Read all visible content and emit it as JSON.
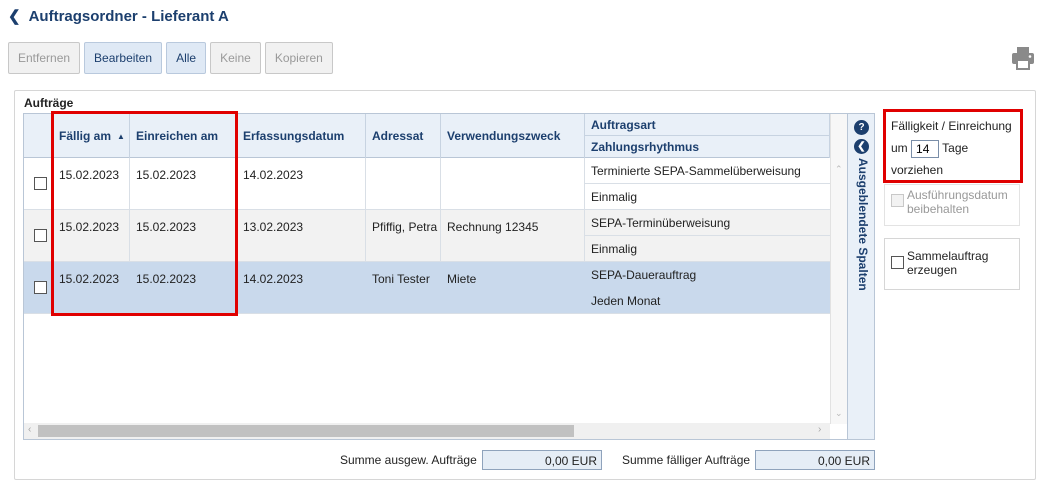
{
  "header": {
    "title": "Auftragsordner - Lieferant A"
  },
  "toolbar": {
    "buttons": [
      {
        "label": "Entfernen"
      },
      {
        "label": "Bearbeiten"
      },
      {
        "label": "Alle"
      },
      {
        "label": "Keine"
      },
      {
        "label": "Kopieren"
      }
    ]
  },
  "group": {
    "label": "Aufträge"
  },
  "table": {
    "columns": {
      "faellig": "Fällig am",
      "einreichen": "Einreichen am",
      "erfassung": "Erfassungsdatum",
      "adressat": "Adressat",
      "verwendung": "Verwendungszweck",
      "auftragsart": "Auftragsart",
      "rhythmus": "Zahlungsrhythmus"
    },
    "rows": [
      {
        "faellig": "15.02.2023",
        "einreichen": "15.02.2023",
        "erfassung": "14.02.2023",
        "adressat": "",
        "verwendung": "",
        "auftragsart": "Terminierte SEPA-Sammelüberweisung",
        "rhythmus": "Einmalig",
        "selected": false
      },
      {
        "faellig": "15.02.2023",
        "einreichen": "15.02.2023",
        "erfassung": "13.02.2023",
        "adressat": "Pfiffig, Petra",
        "verwendung": "Rechnung 12345",
        "auftragsart": "SEPA-Terminüberweisung",
        "rhythmus": "Einmalig",
        "selected": false
      },
      {
        "faellig": "15.02.2023",
        "einreichen": "15.02.2023",
        "erfassung": "14.02.2023",
        "adressat": "Toni Tester",
        "verwendung": "Miete",
        "auftragsart": "SEPA-Dauerauftrag",
        "rhythmus": "Jeden Monat",
        "selected": true
      }
    ],
    "hidden_columns_label": "Ausgeblendete Spalten"
  },
  "options": {
    "title": "Fälligkeit / Einreichung",
    "prefix": "um",
    "days": "14",
    "suffix": "Tage",
    "action": "vorziehen",
    "keep_date": {
      "line1": "Ausführungsdatum",
      "line2": "beibehalten"
    },
    "bulk": {
      "line1": "Sammelauftrag",
      "line2": "erzeugen"
    }
  },
  "summary": {
    "selected_label": "Summe ausgew. Aufträge",
    "selected_value": "0,00 EUR",
    "due_label": "Summe fälliger Aufträge",
    "due_value": "0,00 EUR"
  },
  "colors": {
    "accent": "#1c3f6e",
    "highlight": "#e00000",
    "selected_row": "#c9d9ec"
  },
  "icons": [
    "back-chevron-icon",
    "printer-icon",
    "help-icon",
    "collapse-icon",
    "sort-ascending-icon"
  ]
}
